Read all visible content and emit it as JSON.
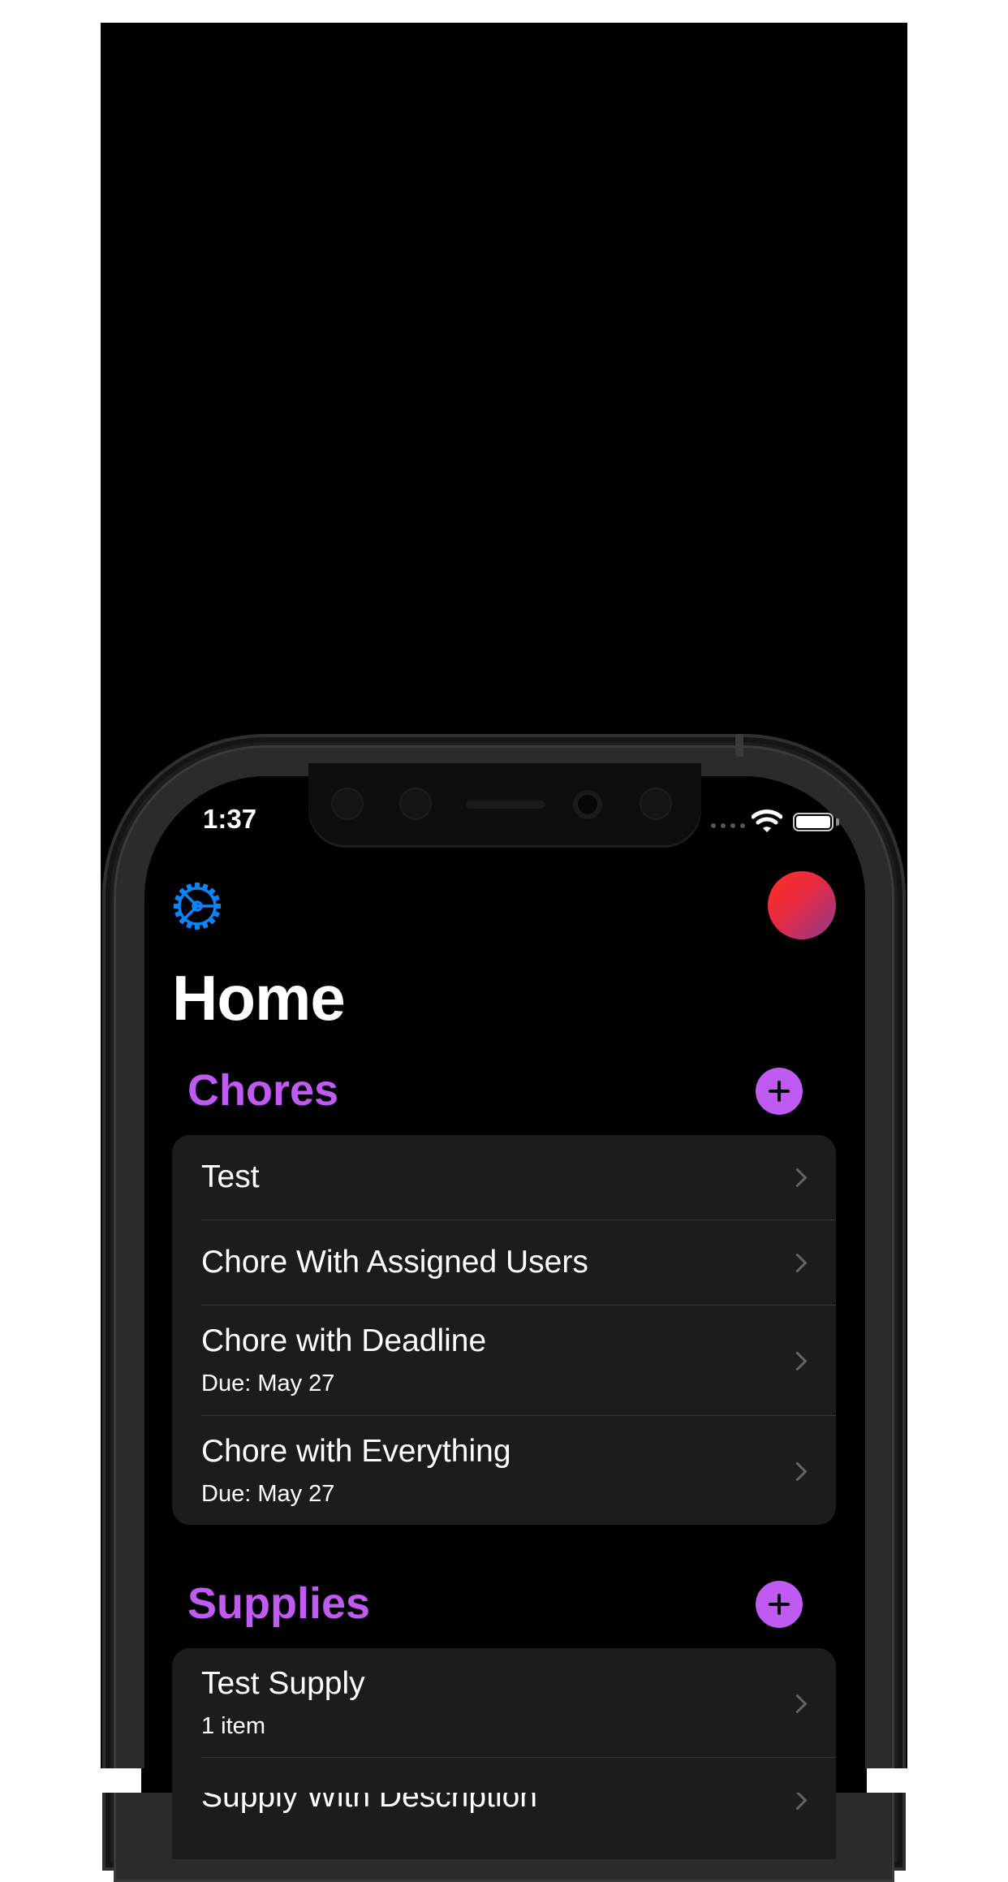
{
  "status_bar": {
    "time": "1:37"
  },
  "nav": {
    "title": "Home"
  },
  "chores": {
    "title": "Chores",
    "items": [
      {
        "title": "Test"
      },
      {
        "title": "Chore With Assigned Users"
      },
      {
        "title": "Chore with Deadline",
        "subtitle": "Due: May 27"
      },
      {
        "title": "Chore with Everything",
        "subtitle": "Due: May 27"
      }
    ]
  },
  "supplies": {
    "title": "Supplies",
    "items": [
      {
        "title": "Test Supply",
        "subtitle": "1 item"
      },
      {
        "title": "Supply With Description"
      }
    ]
  },
  "colors": {
    "accent": "#bf5af2",
    "settings_icon": "#0a84ff",
    "card_bg": "#1c1c1e",
    "background": "#000000"
  },
  "icons": [
    "settings-gear-icon",
    "avatar",
    "add-icon",
    "chevron-right-icon",
    "wifi-icon",
    "battery-icon"
  ]
}
